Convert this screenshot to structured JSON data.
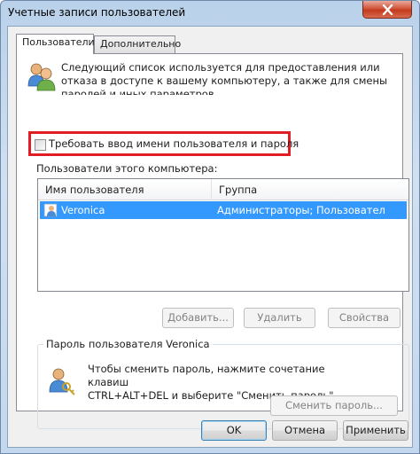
{
  "window": {
    "title": "Учетные записи пользователей"
  },
  "tabs": [
    {
      "label": "Пользователи",
      "active": true
    },
    {
      "label": "Дополнительно",
      "active": false
    }
  ],
  "users_tab": {
    "description": "Следующий список используется для предоставления или отказа в доступе к вашему компьютеру, а также для смены паролей и иных параметров",
    "require_login": {
      "label": "Требовать ввод имени пользователя и пароля",
      "checked": false
    },
    "list_label": "Пользователи этого компьютера:",
    "columns": [
      "Имя пользователя",
      "Группа"
    ],
    "rows": [
      {
        "user": "Veronica",
        "group": "Администраторы; Пользовател...",
        "selected": true
      }
    ],
    "buttons": {
      "add": "Добавить...",
      "remove": "Удалить",
      "properties": "Свойства"
    },
    "password_group": {
      "title": "Пароль пользователя Veronica",
      "text_line1": "Чтобы сменить пароль, нажмите сочетание клавиш",
      "text_line2": "CTRL+ALT+DEL и выберите \"Сменить пароль\".",
      "change_button": "Сменить пароль..."
    }
  },
  "dialog_buttons": {
    "ok": "OK",
    "cancel": "Отмена",
    "apply": "Применить"
  },
  "colors": {
    "highlight_border": "#e01c24",
    "selection": "#3399ff"
  }
}
